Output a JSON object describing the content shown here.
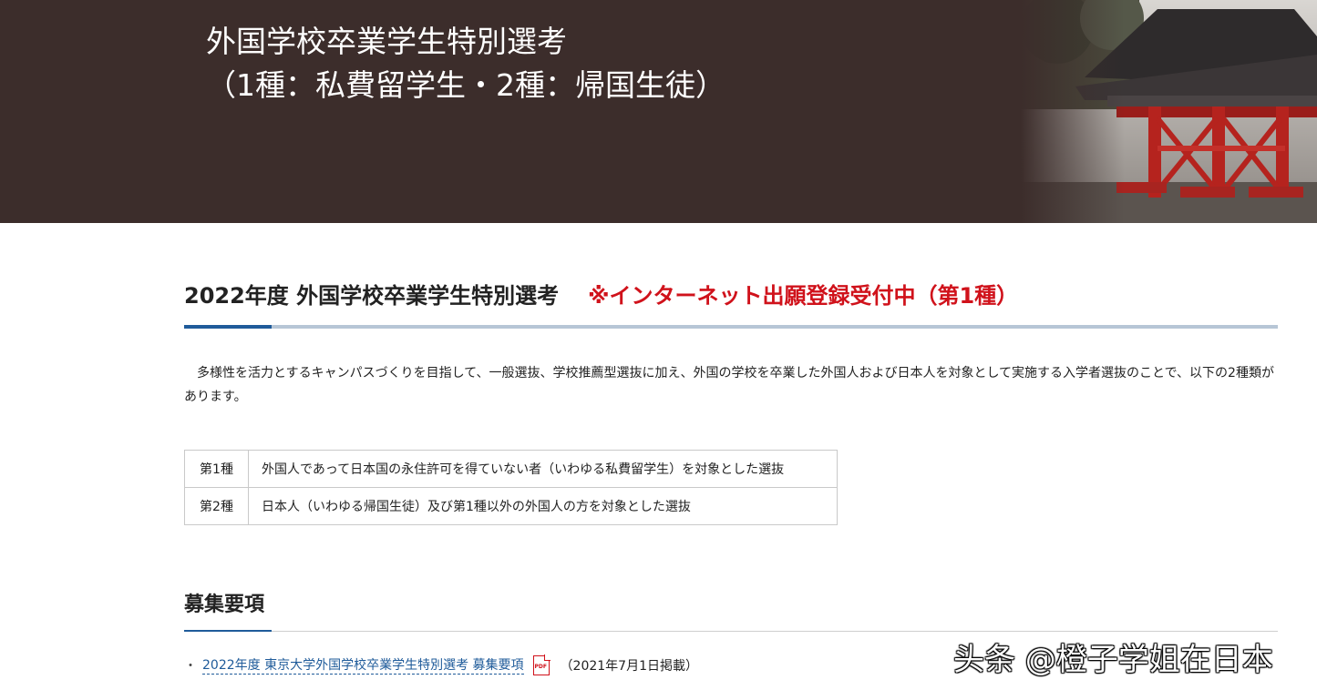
{
  "hero": {
    "title_line1": "外国学校卒業学生特別選考",
    "title_line2": "（1種：私費留学生・2種：帰国生徒）",
    "photo": "red-temple-gate-photo"
  },
  "section": {
    "title": "2022年度 外国学校卒業学生特別選考",
    "notice": "※インターネット出願登録受付中（第1種）",
    "intro": "多様性を活力とするキャンパスづくりを目指して、一般選抜、学校推薦型選抜に加え、外国の学校を卒業した外国人および日本人を対象として実施する入学者選抜のことで、以下の2種類があります。"
  },
  "types": [
    {
      "kind": "第1種",
      "description": "外国人であって日本国の永住許可を得ていない者（いわゆる私費留学生）を対象とした選抜"
    },
    {
      "kind": "第2種",
      "description": "日本人（いわゆる帰国生徒）及び第1種以外の外国人の方を対象とした選抜"
    }
  ],
  "recruitment": {
    "title": "募集要項",
    "items": [
      {
        "bullet": "・",
        "link_text": "2022年度 東京大学外国学校卒業学生特別選考 募集要項",
        "icon": "pdf-icon",
        "icon_label": "PDF",
        "date": "（2021年7月1日掲載）"
      }
    ]
  },
  "watermark": "头条 @橙子学姐在日本",
  "colors": {
    "hero_bg": "#3c2d2b",
    "accent_blue": "#1f5b9a",
    "rule_light": "#b7c6d6",
    "notice_red": "#d0121b"
  }
}
